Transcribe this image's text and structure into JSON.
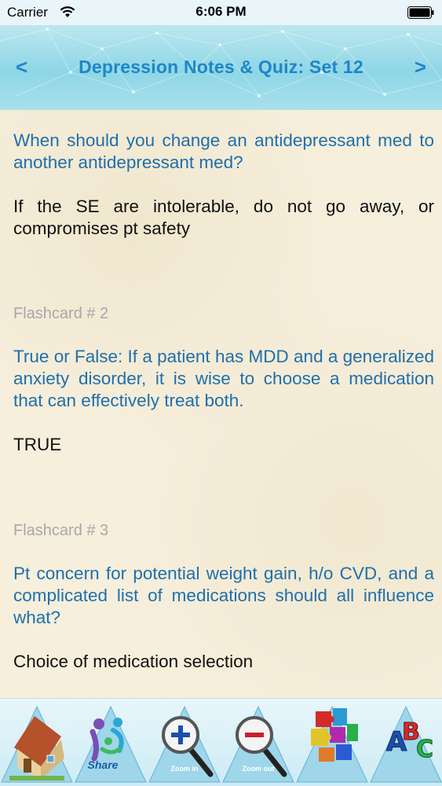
{
  "status_bar": {
    "carrier": "Carrier",
    "time": "6:06 PM"
  },
  "nav": {
    "title": "Depression Notes & Quiz: Set 12",
    "back_glyph": "<",
    "forward_glyph": ">"
  },
  "cards": [
    {
      "question": "When should you change an antidepressant med to another antidepressant med?",
      "answer": "If the SE are intolerable, do not go away, or compromises pt safety"
    },
    {
      "label": "Flashcard # 2",
      "question": "True or False: If a patient has MDD and a generalized anxiety disorder, it is wise to choose a medication that can effectively treat both.",
      "answer": "TRUE"
    },
    {
      "label": "Flashcard # 3",
      "question": "Pt concern for potential weight gain, h/o CVD, and a complicated list of medications should all influence what?",
      "answer": "Choice of medication selection"
    }
  ],
  "toolbar": {
    "home_icon": "house-icon",
    "share_label": "Share",
    "zoom_in_label": "Zoom in",
    "zoom_out_label": "Zoom out",
    "puzzle_icon": "puzzle-icon",
    "abc_icon": "abc-blocks-icon"
  },
  "colors": {
    "accent": "#1f86c8",
    "question_text": "#1f6fad",
    "answer_text": "#111111",
    "flashcard_label": "#a8a8a8",
    "page_background": "#f6efdc"
  }
}
